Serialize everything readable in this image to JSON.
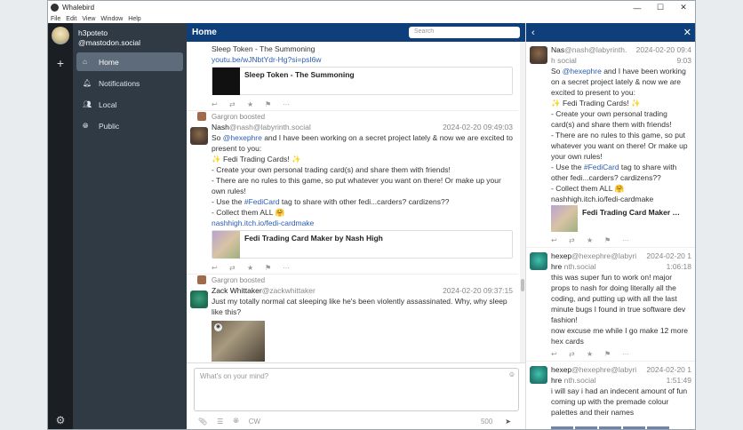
{
  "window": {
    "title": "Whalebird",
    "controls": [
      "—",
      "☐",
      "✕"
    ],
    "menu": [
      "File",
      "Edit",
      "View",
      "Window",
      "Help"
    ]
  },
  "account": {
    "display_name": "h3poteto",
    "acct": "@mastodon.social"
  },
  "sidebar": {
    "items": [
      {
        "label": "Home",
        "icon": "home-icon",
        "active": true
      },
      {
        "label": "Notifications",
        "icon": "bell-icon",
        "active": false
      },
      {
        "label": "Local",
        "icon": "users-icon",
        "active": false
      },
      {
        "label": "Public",
        "icon": "globe-icon",
        "active": false
      }
    ]
  },
  "timeline": {
    "title": "Home",
    "search_placeholder": "Search",
    "top_status": {
      "name": "Sleep Token - The Summoning",
      "link": "youtu.be/wJNbtYdr-Hg?si=psI6w",
      "card_title": "Sleep Token - The Summoning"
    },
    "status2": {
      "boosted_by": "Gargron boosted",
      "name": "Nash",
      "acct": "@nash@labyrinth.social",
      "time": "2024-02-20 09:49:03",
      "lines": [
        "So ",
        "@hexephre",
        " and I have been working on a secret project lately & now we are excited to present to you:",
        "✨ Fedi Trading Cards! ✨",
        "- Create your own personal trading card(s) and share them with friends!",
        "- There are no rules to this game, so put whatever you want on there! Or make up your own rules!",
        "- Use the ",
        "#FediCard",
        " tag to share with other fedi...carders? cardizens??",
        "- Collect them ALL 🤗"
      ],
      "link": "nashhigh.itch.io/fedi-cardmake",
      "card_title": "Fedi Trading Card Maker by Nash High"
    },
    "status3": {
      "boosted_by": "Gargron boosted",
      "name": "Zack Whittaker",
      "acct": "@zackwhittaker",
      "time": "2024-02-20 09:37:15",
      "text": "Just my totally normal cat sleeping like he's been violently assassinated. Why, why sleep like this?"
    },
    "toolbar_icons": [
      "↩",
      "⇄",
      "★",
      "⚑",
      "···"
    ]
  },
  "compose": {
    "placeholder": "What's on your mind?",
    "cw_label": "CW",
    "char_count": "500"
  },
  "detail": {
    "status1": {
      "name": "Nas",
      "acct_line1": "@nash@labyrinth.",
      "acct_line2": "h social",
      "time1": "2024-02-20 09:4",
      "time2": "9:03",
      "lines": [
        "So ",
        "@hexephre",
        " and I have been working on a secret project lately & now we are excited to present to you:",
        "✨ Fedi Trading Cards! ✨",
        "- Create your own personal trading card(s) and share them with friends!",
        "- There are no rules to this game, so put whatever you want on there! Or make up your own rules!",
        "- Use the ",
        "#FediCard",
        " tag to share with other fedi...carders? cardizens??",
        "- Collect them ALL 🤗"
      ],
      "link": "nashhigh.itch.io/fedi-cardmake",
      "card_title": "Fedi Trading Card Maker …"
    },
    "status2": {
      "name": "hexep",
      "acct_line1": "@hexephre@labyri",
      "name2": "hre",
      "acct_line2": "nth.social",
      "time1": "2024-02-20 1",
      "time2": "1:06:18",
      "text": "this was super fun to work on! major props to nash for doing literally all the coding, and putting up with all the last minute bugs I found in true software dev fashion!",
      "text2": "now excuse me while I go make 12 more hex cards"
    },
    "status3": {
      "name": "hexep",
      "acct_line1": "@hexephre@labyri",
      "name2": "hre",
      "acct_line2": "nth.social",
      "time1": "2024-02-20 1",
      "time2": "1:51:49",
      "text": "i will say i had an indecent amount of fun coming up with the premade colour palettes and their names"
    }
  }
}
